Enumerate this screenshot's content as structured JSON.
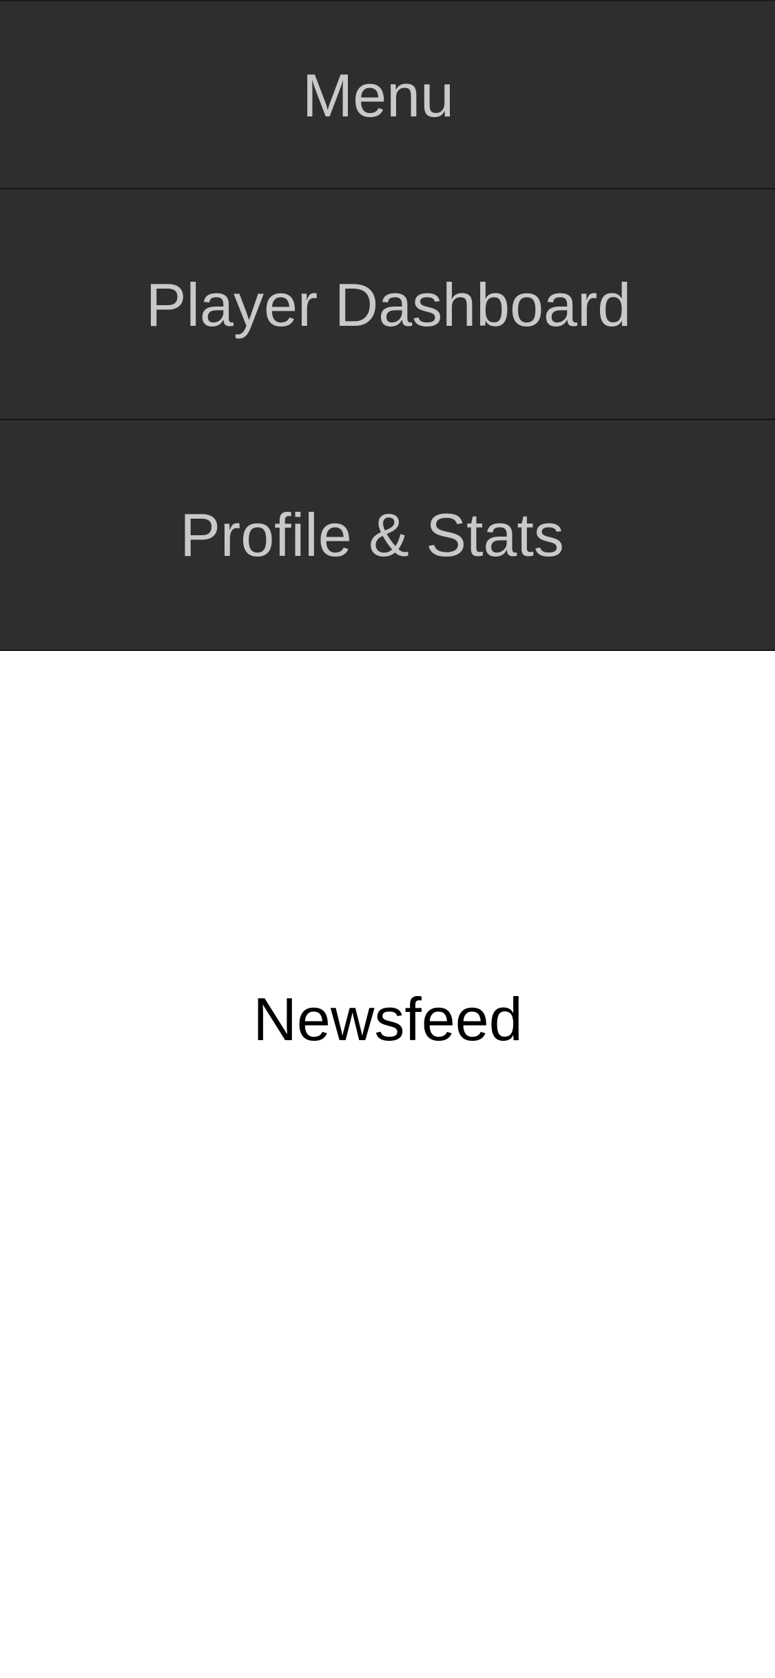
{
  "menu": {
    "title": "Menu",
    "items": [
      {
        "label": "Player Dashboard"
      },
      {
        "label": "Profile & Stats"
      }
    ]
  },
  "main": {
    "label": "Newsfeed"
  },
  "colors": {
    "menu_background": "#2e2e2e",
    "menu_text": "#c9c9c9",
    "divider": "#141414",
    "content_background": "#ffffff",
    "content_text": "#000000"
  }
}
